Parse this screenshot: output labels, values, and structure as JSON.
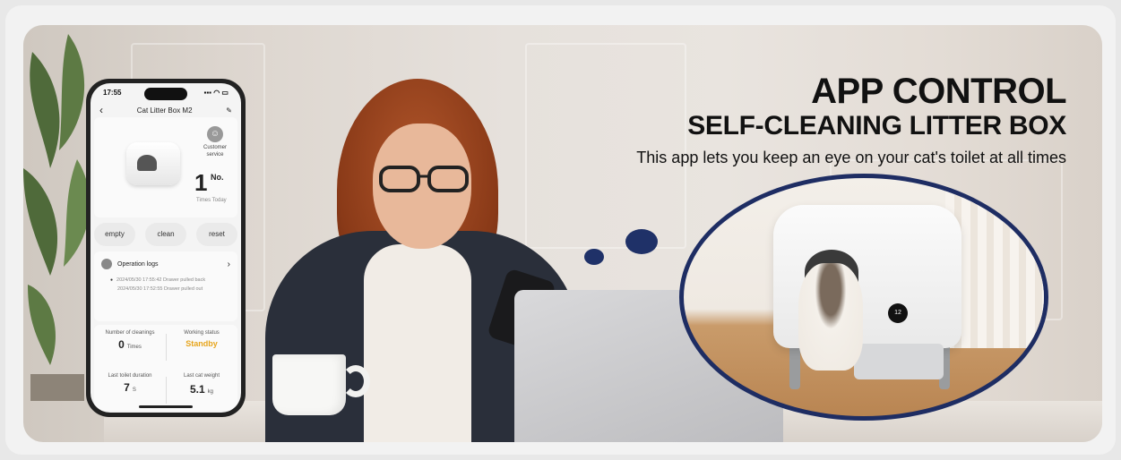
{
  "headline": {
    "title": "APP CONTROL",
    "subtitle": "SELF-CLEANING LITTER BOX",
    "tagline": "This app lets you keep an eye on your cat's toilet at all times"
  },
  "phone": {
    "time": "17:55",
    "status_icons": "▪▪▪ ◠ ▭",
    "nav_title": "Cat Litter Box M2",
    "back_icon": "‹",
    "edit_icon": "✎",
    "customer_service_label": "Customer service",
    "count_value": "1",
    "count_unit": "No.",
    "count_label": "Times Today",
    "buttons": [
      "empty",
      "clean",
      "reset"
    ],
    "logs": {
      "title": "Operation logs",
      "chevron": "›",
      "entries": [
        "2024/05/30 17:55:42 Drawer pulled back",
        "2024/05/30 17:52:55 Drawer pulled out"
      ]
    },
    "stats": {
      "cleanings_label": "Number of cleanings",
      "cleanings_value": "0",
      "cleanings_unit": "Times",
      "status_label": "Working status",
      "status_value": "Standby",
      "duration_label": "Last toilet duration",
      "duration_value": "7",
      "duration_unit": "S",
      "weight_label": "Last cat weight",
      "weight_value": "5.1",
      "weight_unit": "kg"
    }
  },
  "product": {
    "screen_value": "12"
  },
  "colors": {
    "accent_navy": "#1e2d63",
    "status_orange": "#e7a51d"
  }
}
